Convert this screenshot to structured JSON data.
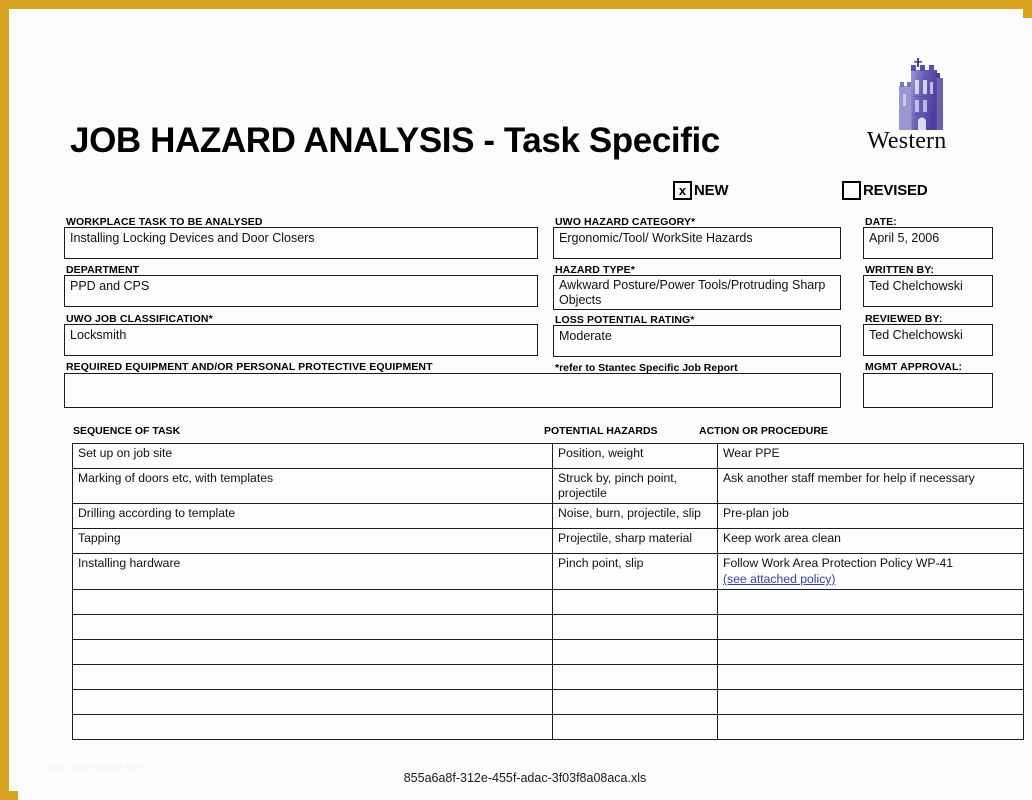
{
  "document": {
    "title": "JOB HAZARD ANALYSIS - Task Specific",
    "logo_word": "Western",
    "logo_icon": "western-tower-logo",
    "border_color": "#d8a420",
    "link_color": "#3b3bbf"
  },
  "status_checkboxes": {
    "new": {
      "label": "NEW",
      "mark": "x",
      "checked": true
    },
    "revised": {
      "label": "REVISED",
      "mark": "",
      "checked": false
    }
  },
  "fields": {
    "workplace_task": {
      "label": "WORKPLACE TASK TO BE ANALYSED",
      "value": "Installing Locking Devices and Door Closers"
    },
    "department": {
      "label": "DEPARTMENT",
      "value": "PPD and CPS"
    },
    "job_classification": {
      "label": "UWO JOB CLASSIFICATION*",
      "value": "Locksmith"
    },
    "required_equipment": {
      "label": "REQUIRED EQUIPMENT AND/OR PERSONAL PROTECTIVE EQUIPMENT",
      "value": ""
    },
    "hazard_category": {
      "label": "UWO HAZARD CATEGORY*",
      "value": "Ergonomic/Tool/ WorkSite Hazards"
    },
    "hazard_type": {
      "label": "HAZARD TYPE*",
      "value": "Awkward Posture/Power Tools/Protruding Sharp Objects"
    },
    "loss_potential_rating": {
      "label": "LOSS POTENTIAL RATING*",
      "value": "Moderate"
    },
    "refer_note": "*refer to Stantec Specific Job Report",
    "date": {
      "label": "DATE:",
      "value": "April 5, 2006"
    },
    "written_by": {
      "label": "WRITTEN BY:",
      "value": "Ted Chelchowski"
    },
    "reviewed_by": {
      "label": "REVIEWED BY:",
      "value": "Ted Chelchowski"
    },
    "mgmt_approval": {
      "label": "MGMT APPROVAL:",
      "value": ""
    }
  },
  "task_table": {
    "headers": [
      "SEQUENCE OF TASK",
      "POTENTIAL HAZARDS",
      "ACTION OR PROCEDURE"
    ],
    "rows": [
      {
        "sequence": "Set up on job site",
        "hazards": "Position, weight",
        "action": "Wear PPE",
        "link": ""
      },
      {
        "sequence": "Marking of doors etc, with templates",
        "hazards": "Struck by, pinch point, projectile",
        "action": "Ask another staff member for help if necessary",
        "link": ""
      },
      {
        "sequence": "Drilling according to template",
        "hazards": "Noise, burn, projectile, slip",
        "action": "Pre-plan job",
        "link": ""
      },
      {
        "sequence": "Tapping",
        "hazards": "Projectile, sharp material",
        "action": "Keep work area clean",
        "link": ""
      },
      {
        "sequence": "Installing hardware",
        "hazards": "Pinch point, slip",
        "action": "Follow Work Area Protection Policy WP-41",
        "link": "(see attached policy)"
      },
      {
        "sequence": "",
        "hazards": "",
        "action": "",
        "link": ""
      },
      {
        "sequence": "",
        "hazards": "",
        "action": "",
        "link": ""
      },
      {
        "sequence": "",
        "hazards": "",
        "action": "",
        "link": ""
      },
      {
        "sequence": "",
        "hazards": "",
        "action": "",
        "link": ""
      },
      {
        "sequence": "",
        "hazards": "",
        "action": "",
        "link": ""
      },
      {
        "sequence": "",
        "hazards": "",
        "action": "",
        "link": ""
      }
    ]
  },
  "footer": {
    "filename": "855a6a8f-312e-455f-adac-3f03f8a08aca.xls",
    "watermark": "www.hypertoolbox.com"
  }
}
